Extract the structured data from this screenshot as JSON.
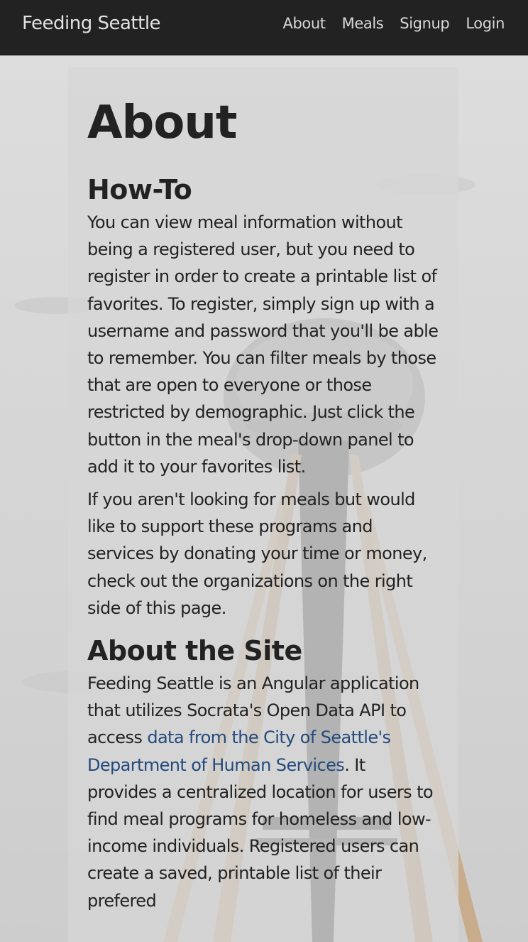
{
  "navbar": {
    "brand": "Feeding Seattle",
    "links": [
      "About",
      "Meals",
      "Signup",
      "Login"
    ]
  },
  "main": {
    "title": "About",
    "howto": {
      "heading": "How-To",
      "paragraph1": "You can view meal information without being a registered user, but you need to register in order to create a printable list of favorites. To register, simply sign up with a username and password that you'll be able to remember. You can filter meals by those that are open to everyone or those restricted by demographic. Just click the button in the meal's drop-down panel to add it to your favorites list.",
      "paragraph2": "If you aren't looking for meals but would like to support these programs and services by donating your time or money, check out the organizations on the right side of this page."
    },
    "site": {
      "heading": "About the Site",
      "text_before_link": "Feeding Seattle is an Angular application that utilizes Socrata's Open Data API to access ",
      "link_text": "data from the City of Seattle's Department of Human Services",
      "text_after_link": ". It provides a centralized location for users to find meal programs for homeless and low-income individuals. Registered users can create a saved, printable list of their prefered"
    }
  },
  "colors": {
    "navbar_bg": "#222222",
    "link": "#234a7d",
    "text": "#222222"
  },
  "background_image": "space-needle-photo"
}
